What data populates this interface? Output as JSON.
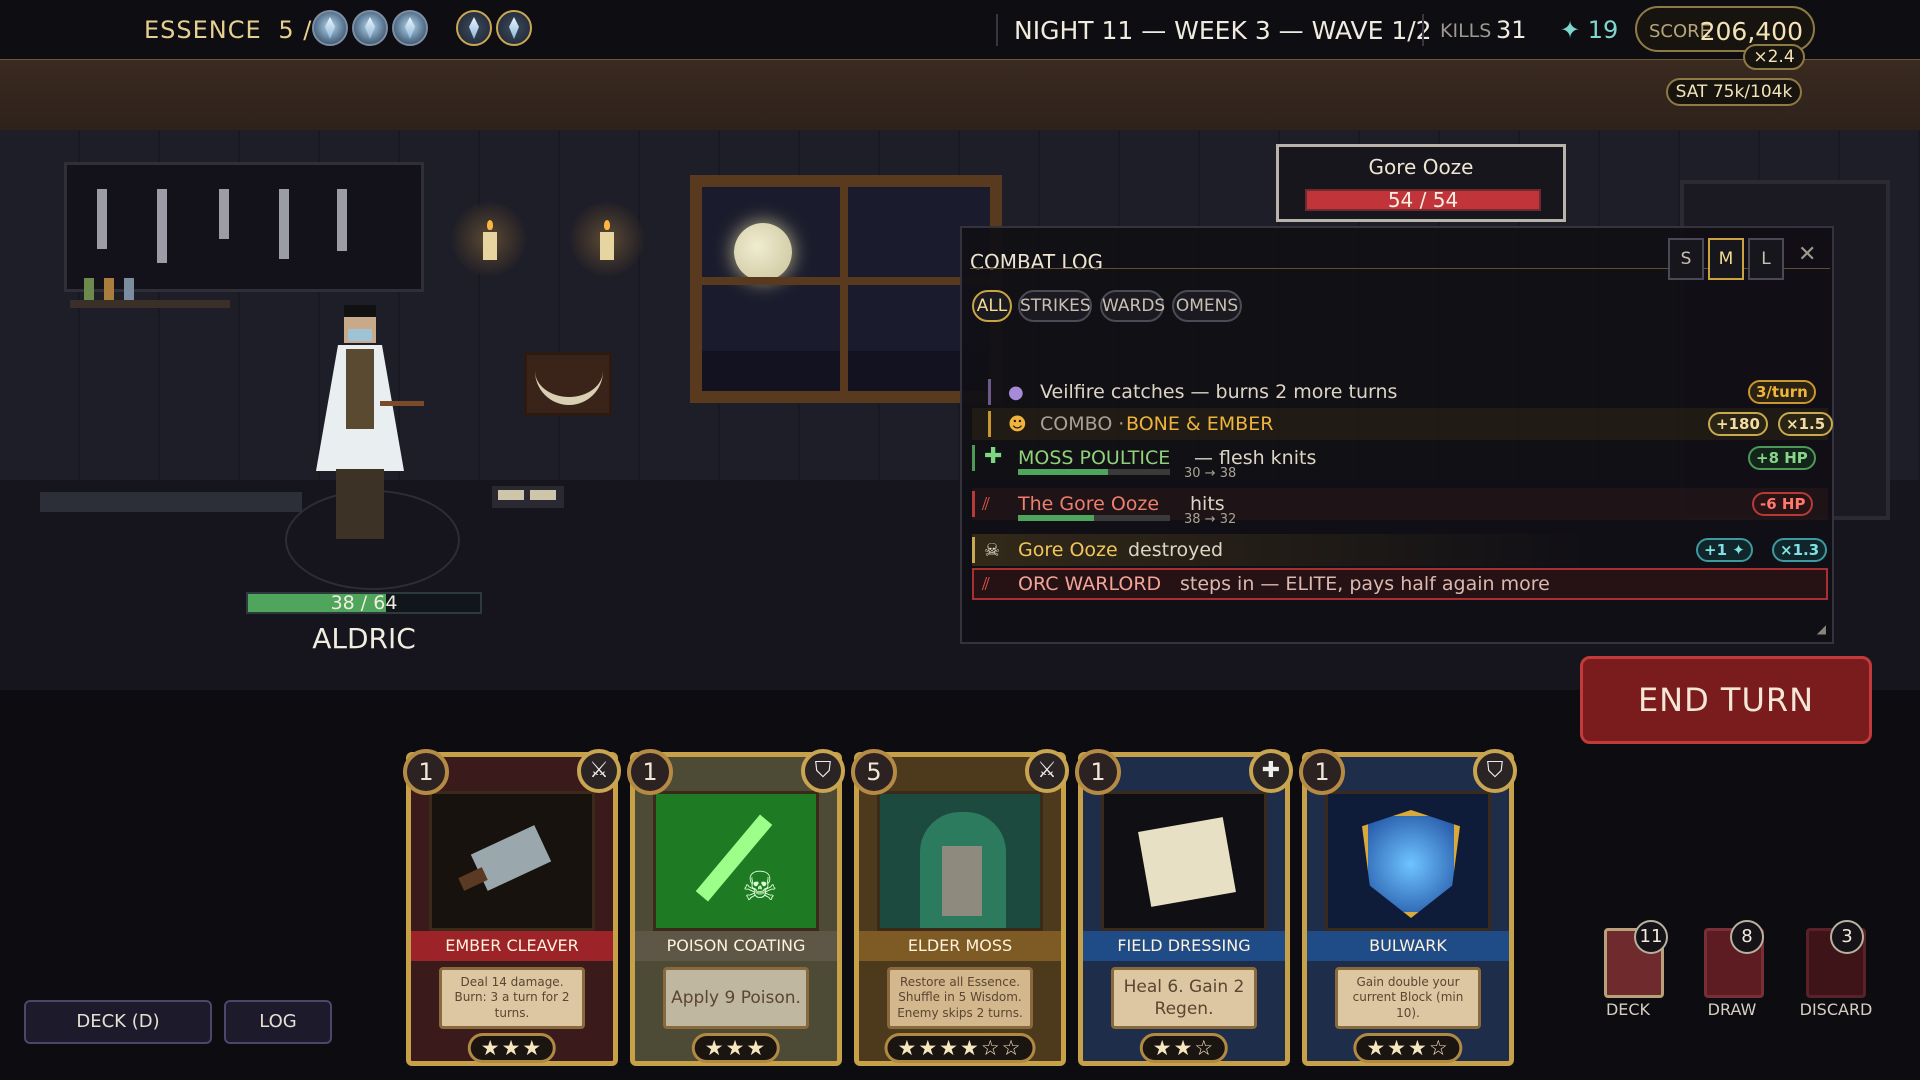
{
  "hud": {
    "essence_label": "ESSENCE",
    "essence_value": "5 / 3",
    "night": "NIGHT 11 — WEEK 3 — WAVE 1/2",
    "kills_label": "KILLS",
    "kills_value": "31",
    "shards_value": "✦ 19",
    "score_label": "SCORE",
    "score_value": "206,400",
    "multiplier": "×2.4",
    "sat": "SAT 75k/104k"
  },
  "player": {
    "name": "ALDRIC",
    "hp_text": "38 / 64",
    "hp": 38,
    "hp_max": 64
  },
  "enemy": {
    "name": "Gore Ooze",
    "hp_text": "54 / 54",
    "hp": 54,
    "hp_max": 54
  },
  "combat_log": {
    "title": "COMBAT LOG",
    "sizes": [
      "S",
      "M",
      "L"
    ],
    "active_size": "M",
    "close_icon": "✕",
    "filters": [
      "ALL",
      "STRIKES",
      "WARDS",
      "OMENS"
    ],
    "active_filter": "ALL",
    "entries": [
      {
        "text": "Veilfire catches — burns 2 more turns",
        "chip1": "3/turn"
      },
      {
        "label": "COMBO ·",
        "text": "BONE & EMBER",
        "chip1": "+180",
        "chip2": "×1.5"
      },
      {
        "name": "MOSS POULTICE",
        "text": "— flesh knits",
        "chip1": "+8 HP",
        "bar_text": "30 → 38",
        "bar_from": 30,
        "bar_to": 38
      },
      {
        "name": "The Gore Ooze",
        "text": "hits",
        "chip1": "-6 HP",
        "bar_text": "38 → 32",
        "bar_from": 38,
        "bar_to": 32
      },
      {
        "name": "Gore Ooze",
        "text": "destroyed",
        "chip1": "+1 ✦",
        "chip2": "×1.3"
      },
      {
        "name": "ORC WARLORD",
        "text": "steps in — ELITE, pays half again more"
      }
    ]
  },
  "end_turn": "END TURN",
  "hand": [
    {
      "name": "EMBER CLEAVER",
      "cost": "1",
      "desc": "Deal 14 damage. Burn: 3 a turn for 2 turns.",
      "stars": "★★★",
      "type_icon": "blade-icon"
    },
    {
      "name": "POISON COATING",
      "cost": "1",
      "desc": "Apply 9 Poison.",
      "stars": "★★★",
      "type_icon": "shield-icon"
    },
    {
      "name": "ELDER MOSS",
      "cost": "5",
      "desc": "Restore all Essence. Shuffle in 5 Wisdom. Enemy skips 2 turns.",
      "stars": "★★★★☆☆",
      "type_icon": "blade-icon"
    },
    {
      "name": "FIELD DRESSING",
      "cost": "1",
      "desc": "Heal 6. Gain 2 Regen.",
      "stars": "★★☆",
      "type_icon": "plus-icon"
    },
    {
      "name": "BULWARK",
      "cost": "1",
      "desc": "Gain double your current Block (min 10).",
      "stars": "★★★☆",
      "type_icon": "shield-icon"
    }
  ],
  "piles": [
    {
      "label": "DECK",
      "count": "11"
    },
    {
      "label": "DRAW",
      "count": "8"
    },
    {
      "label": "DISCARD",
      "count": "3"
    }
  ],
  "buttons": {
    "deck": "DECK (D)",
    "log": "LOG"
  },
  "colors": {
    "accent_gold": "#c9a440",
    "end_turn": "#7a1b1e",
    "hp_green": "#4fa55b",
    "enemy_red": "#c0343a"
  }
}
